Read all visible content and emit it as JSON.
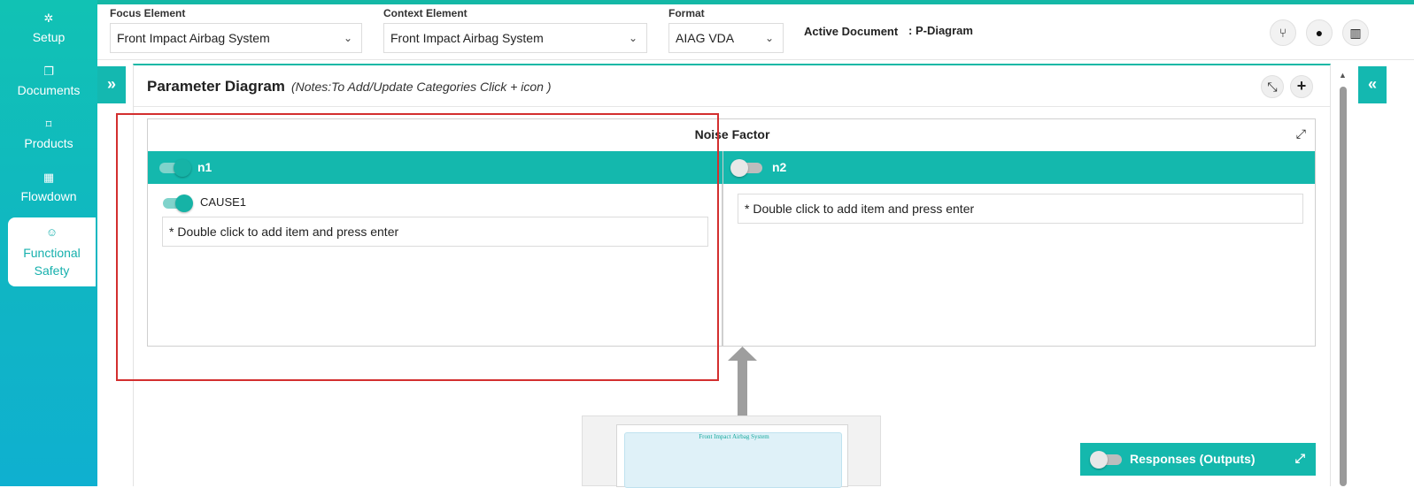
{
  "sidebar": {
    "items": [
      {
        "label": "Setup",
        "icon": "gears-icon"
      },
      {
        "label": "Documents",
        "icon": "copy-icon"
      },
      {
        "label": "Products",
        "icon": "product-icon"
      },
      {
        "label": "Flowdown",
        "icon": "building-icon"
      },
      {
        "label": "Functional Safety",
        "icon": "safety-icon",
        "active": true
      }
    ]
  },
  "topbar": {
    "focus_label": "Focus Element",
    "focus_value": "Front Impact Airbag System",
    "context_label": "Context Element",
    "context_value": "Front Impact Airbag System",
    "format_label": "Format",
    "format_value": "AIAG VDA",
    "active_doc_label": "Active Document",
    "active_doc_value": ": P-Diagram",
    "buttons": [
      "branch-icon",
      "drop-icon",
      "bar-chart-icon"
    ]
  },
  "panel": {
    "title": "Parameter Diagram",
    "note": "(Notes:To Add/Update Categories Click + icon )"
  },
  "noise": {
    "title": "Noise Factor",
    "columns": [
      {
        "label": "n1",
        "toggle_on": true,
        "cause": "CAUSE1",
        "cause_on": true,
        "placeholder": "* Double click to add item and press enter"
      },
      {
        "label": "n2",
        "toggle_on": false,
        "placeholder": "* Double click to add item and press enter"
      }
    ]
  },
  "center": {
    "title": "Front Impact Airbag System"
  },
  "responses": {
    "label": "Responses (Outputs)",
    "toggle_on": false
  },
  "colors": {
    "accent": "#14b8ad",
    "highlight": "#d32f2f"
  }
}
